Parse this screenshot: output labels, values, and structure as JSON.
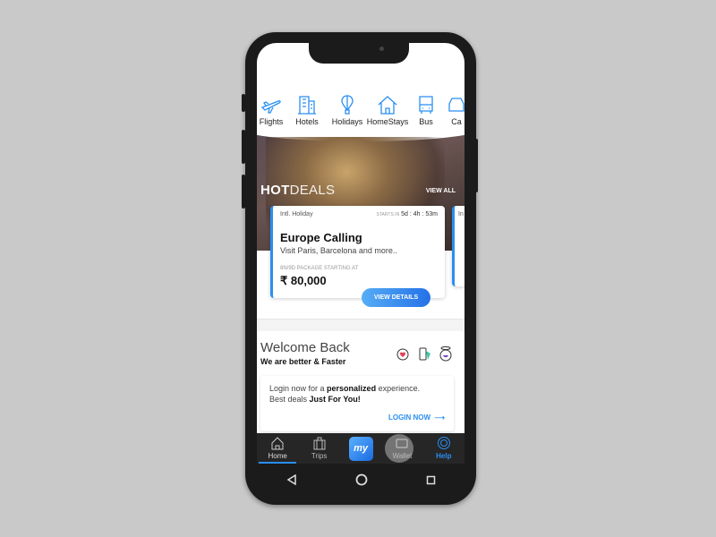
{
  "categories": [
    {
      "label": "Flights",
      "icon": "airplane-icon"
    },
    {
      "label": "Hotels",
      "icon": "building-icon"
    },
    {
      "label": "Holidays",
      "icon": "hot-air-balloon-icon"
    },
    {
      "label": "HomeStays",
      "icon": "house-icon"
    },
    {
      "label": "Bus",
      "icon": "bus-icon"
    },
    {
      "label": "Ca",
      "icon": "car-icon"
    }
  ],
  "hot_deals": {
    "title_bold": "HOT",
    "title_light": "DEALS",
    "view_all": "VIEW ALL"
  },
  "deal": {
    "tag": "Intl. Holiday",
    "starts_in_label": "STARTS IN",
    "timer": "5d : 4h : 53m",
    "title": "Europe Calling",
    "subtitle": "Visit Paris, Barcelona and more..",
    "package_label": "8N/9D PACKAGE STARTING AT",
    "price": "₹ 80,000",
    "button": "VIEW DETAILS"
  },
  "deal2": {
    "tag": "In"
  },
  "welcome": {
    "title": "Welcome Back",
    "subtitle": "We are better & Faster",
    "login_text_1": "Login now for a ",
    "login_bold_1": "personalized",
    "login_text_2": " experience.",
    "login_text_3": "Best deals ",
    "login_bold_2": "Just For You!",
    "login_button": "LOGIN NOW",
    "icons": [
      "heart-badge-icon",
      "phone-card-icon",
      "smiley-halo-icon"
    ]
  },
  "tabs": [
    {
      "label": "Home",
      "active": true
    },
    {
      "label": "Trips"
    },
    {
      "label": "my",
      "logo": true
    },
    {
      "label": "Wallet"
    },
    {
      "label": "Help",
      "highlight": true
    }
  ],
  "colors": {
    "accent": "#2a8ef2",
    "tabbar": "#262626"
  }
}
